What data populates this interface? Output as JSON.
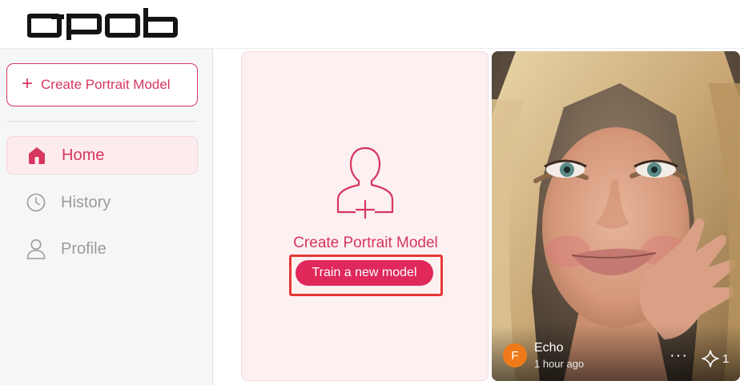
{
  "header": {
    "logo_text": "apob",
    "logo_icon": "apob-wordmark"
  },
  "sidebar": {
    "create_button": {
      "icon": "plus-icon",
      "label": "Create Portrait Model"
    },
    "nav": [
      {
        "label": "Home",
        "icon": "home-icon",
        "active": true
      },
      {
        "label": "History",
        "icon": "clock-icon",
        "active": false
      },
      {
        "label": "Profile",
        "icon": "user-icon",
        "active": false
      }
    ]
  },
  "main": {
    "create_card": {
      "icon": "portrait-add-icon",
      "title": "Create Portrait Model",
      "button_label": "Train a new model"
    },
    "models": [
      {
        "name": "Echo",
        "avatar_letter": "F",
        "time": "1 hour ago",
        "more_icon": "more-horizontal-icon",
        "spark_icon": "sparkle-icon",
        "spark_count": "1"
      }
    ]
  },
  "colors": {
    "accent": "#d7365e",
    "button": "#e0285a",
    "highlight_outline": "#e53935",
    "avatar": "#f07a1a",
    "card_bg": "#fdf0f1",
    "sidebar_bg": "#f5f6f7"
  }
}
